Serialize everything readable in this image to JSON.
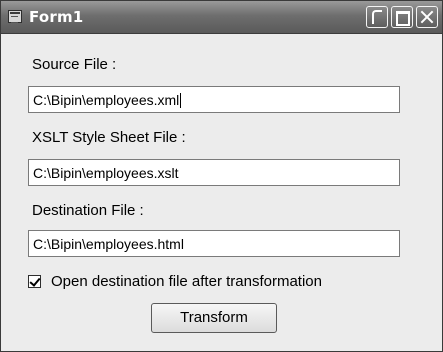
{
  "window": {
    "title": "Form1"
  },
  "form": {
    "source_label": "Source File :",
    "source_value": "C:\\Bipin\\employees.xml",
    "xslt_label": "XSLT Style Sheet File :",
    "xslt_value": "C:\\Bipin\\employees.xslt",
    "destination_label": "Destination File :",
    "destination_value": "C:\\Bipin\\employees.html",
    "open_after_label": "Open destination file after transformation",
    "open_after_checked": true,
    "transform_button": "Transform"
  },
  "icons": {
    "app": "form-app-icon",
    "minimize": "minimize-icon",
    "maximize": "maximize-icon",
    "close": "close-icon"
  }
}
